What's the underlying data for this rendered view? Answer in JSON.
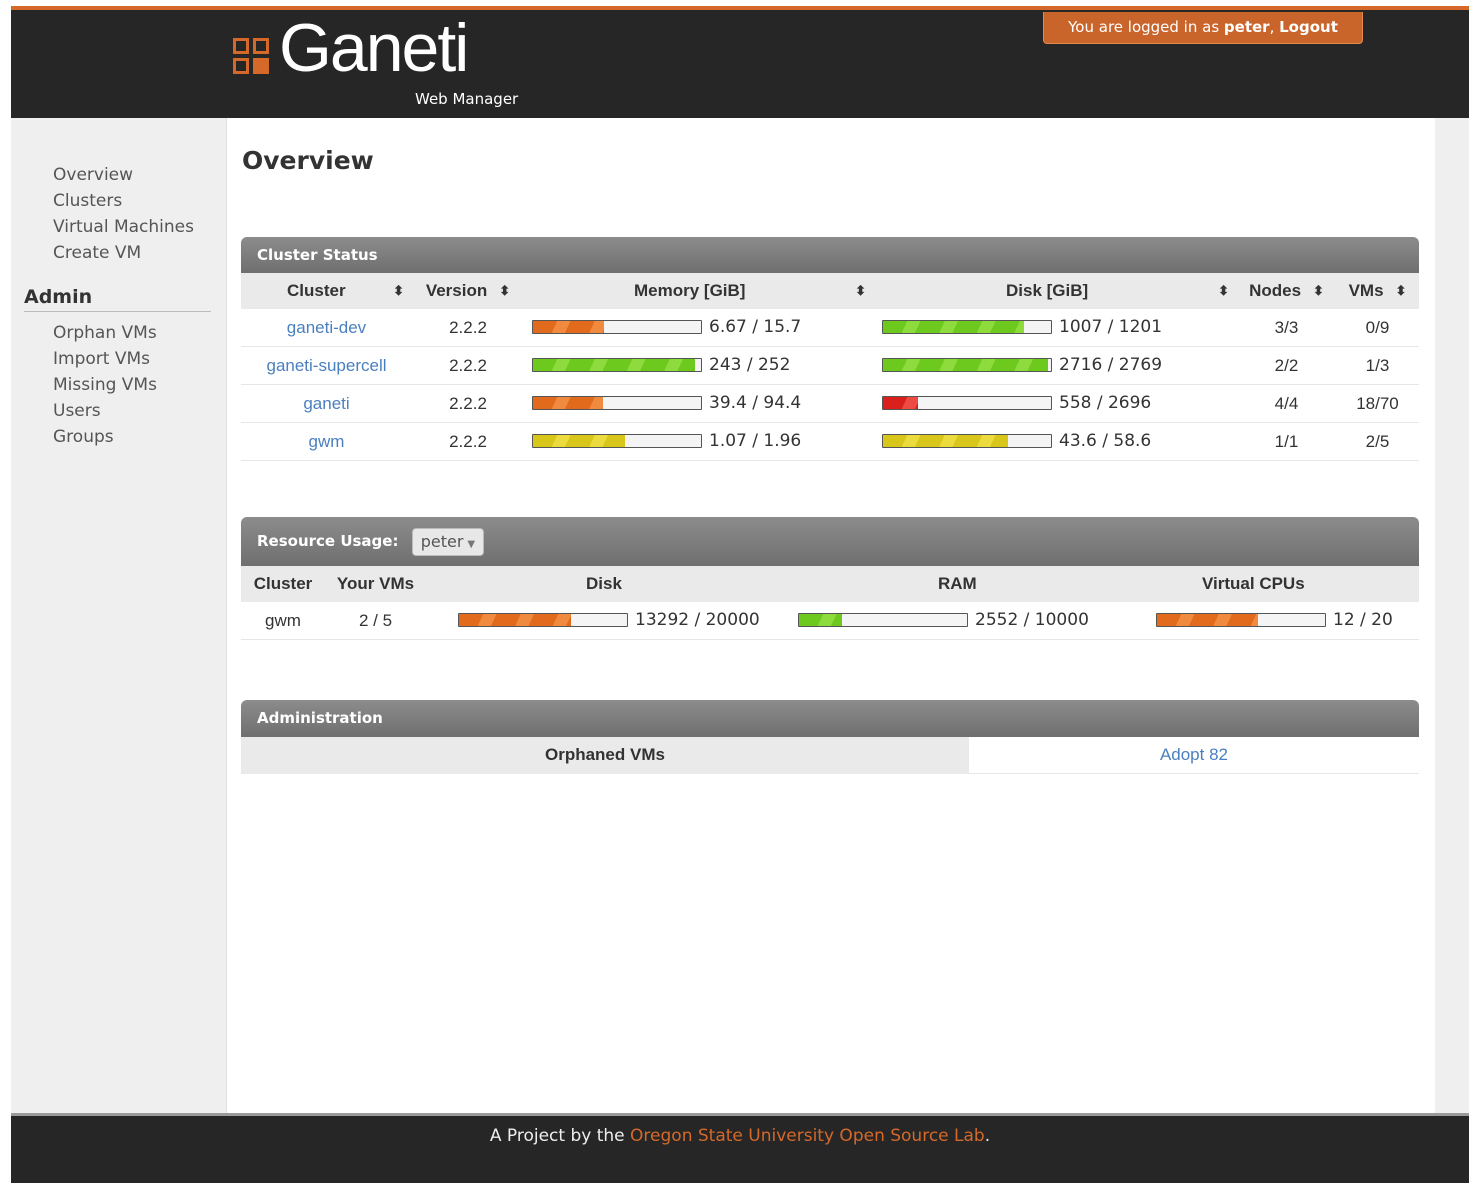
{
  "header": {
    "logo_text": "Ganeti",
    "logo_sub": "Web Manager",
    "login_prefix": "You are logged in as ",
    "username": "peter",
    "separator": ", ",
    "logout": "Logout",
    "accent": "#d4692a"
  },
  "sidebar": {
    "nav": [
      "Overview",
      "Clusters",
      "Virtual Machines",
      "Create VM"
    ],
    "admin_heading": "Admin",
    "admin": [
      "Orphan VMs",
      "Import VMs",
      "Missing VMs",
      "Users",
      "Groups"
    ]
  },
  "main": {
    "title": "Overview",
    "cluster_status": {
      "heading": "Cluster Status",
      "columns": [
        "Cluster",
        "Version",
        "Memory [GiB]",
        "Disk [GiB]",
        "Nodes",
        "VMs"
      ],
      "sort_icon": "⬍",
      "rows": [
        {
          "cluster": "ganeti-dev",
          "version": "2.2.2",
          "memory": "6.67 / 15.7",
          "memory_used": 6.67,
          "memory_total": 15.7,
          "memory_color": "orange",
          "disk": "1007 / 1201",
          "disk_used": 1007,
          "disk_total": 1201,
          "disk_color": "green",
          "nodes": "3/3",
          "vms": "0/9"
        },
        {
          "cluster": "ganeti-supercell",
          "version": "2.2.2",
          "memory": "243 / 252",
          "memory_used": 243,
          "memory_total": 252,
          "memory_color": "green",
          "disk": "2716 / 2769",
          "disk_used": 2716,
          "disk_total": 2769,
          "disk_color": "green",
          "nodes": "2/2",
          "vms": "1/3"
        },
        {
          "cluster": "ganeti",
          "version": "2.2.2",
          "memory": "39.4 / 94.4",
          "memory_used": 39.4,
          "memory_total": 94.4,
          "memory_color": "orange",
          "disk": "558 / 2696",
          "disk_used": 558,
          "disk_total": 2696,
          "disk_color": "red",
          "nodes": "4/4",
          "vms": "18/70"
        },
        {
          "cluster": "gwm",
          "version": "2.2.2",
          "memory": "1.07 / 1.96",
          "memory_used": 1.07,
          "memory_total": 1.96,
          "memory_color": "yellow",
          "disk": "43.6 / 58.6",
          "disk_used": 43.6,
          "disk_total": 58.6,
          "disk_color": "yellow",
          "nodes": "1/1",
          "vms": "2/5"
        }
      ]
    },
    "resource_usage": {
      "heading": "Resource Usage:",
      "selected_user": "peter",
      "columns": [
        "Cluster",
        "Your VMs",
        "Disk",
        "RAM",
        "Virtual CPUs"
      ],
      "rows": [
        {
          "cluster": "gwm",
          "your_vms": "2 / 5",
          "disk": "13292 / 20000",
          "disk_used": 13292,
          "disk_total": 20000,
          "disk_color": "orange",
          "ram": "2552 / 10000",
          "ram_used": 2552,
          "ram_total": 10000,
          "ram_color": "green",
          "cpus": "12 / 20",
          "cpus_used": 12,
          "cpus_total": 20,
          "cpus_color": "orange"
        }
      ]
    },
    "administration": {
      "heading": "Administration",
      "label": "Orphaned VMs",
      "action": "Adopt 82"
    }
  },
  "footer": {
    "prefix": "A Project by the ",
    "org": "Oregon State University Open Source Lab",
    "suffix": "."
  }
}
